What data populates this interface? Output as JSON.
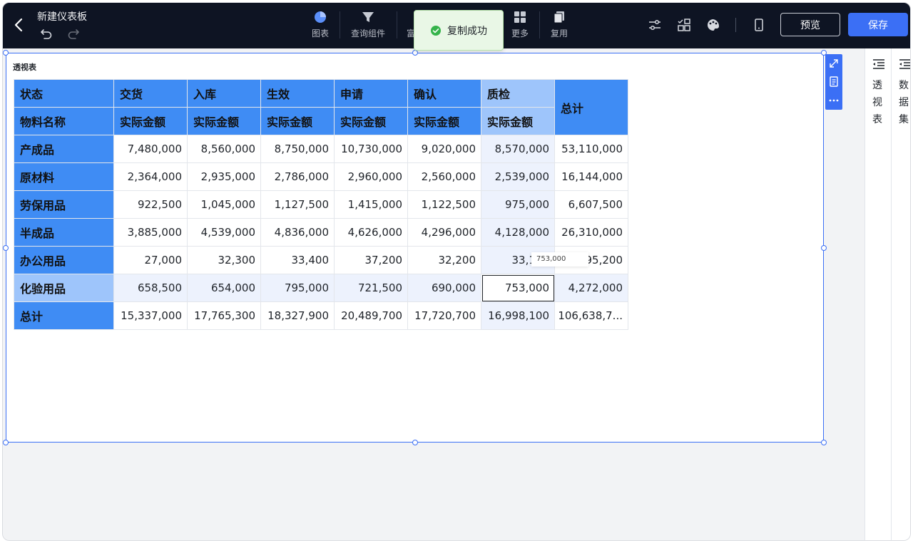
{
  "header": {
    "title": "新建仪表板",
    "toolbar": [
      {
        "label": "图表",
        "icon": "pie-chart-icon"
      },
      {
        "label": "查询组件",
        "icon": "filter-icon"
      },
      {
        "label": "富",
        "icon": "rich-text-icon"
      },
      {
        "label": "更多",
        "icon": "grid-icon"
      },
      {
        "label": "复用",
        "icon": "copy-icon"
      }
    ],
    "preview_label": "预览",
    "save_label": "保存"
  },
  "toast": {
    "message": "复制成功"
  },
  "widget": {
    "title": "透视表",
    "tooltip": "753,000"
  },
  "pivot": {
    "status_header": "状态",
    "material_header": "物料名称",
    "total_header": "总计",
    "statuses": [
      "交货",
      "入库",
      "生效",
      "申请",
      "确认",
      "质检"
    ],
    "measure": "实际金额",
    "rows": [
      {
        "name": "产成品",
        "values": [
          "7,480,000",
          "8,560,000",
          "8,750,000",
          "10,730,000",
          "9,020,000",
          "8,570,000"
        ],
        "total": "53,110,000"
      },
      {
        "name": "原材料",
        "values": [
          "2,364,000",
          "2,935,000",
          "2,786,000",
          "2,960,000",
          "2,560,000",
          "2,539,000"
        ],
        "total": "16,144,000"
      },
      {
        "name": "劳保用品",
        "values": [
          "922,500",
          "1,045,000",
          "1,127,500",
          "1,415,000",
          "1,122,500",
          "975,000"
        ],
        "total": "6,607,500"
      },
      {
        "name": "半成品",
        "values": [
          "3,885,000",
          "4,539,000",
          "4,836,000",
          "4,626,000",
          "4,296,000",
          "4,128,000"
        ],
        "total": "26,310,000"
      },
      {
        "name": "办公用品",
        "values": [
          "27,000",
          "32,300",
          "33,400",
          "37,200",
          "32,200",
          "33,100"
        ],
        "total": "195,200"
      },
      {
        "name": "化验用品",
        "values": [
          "658,500",
          "654,000",
          "795,000",
          "721,500",
          "690,000",
          "753,000"
        ],
        "total": "4,272,000"
      }
    ],
    "grand_total": {
      "name": "总计",
      "values": [
        "15,337,000",
        "17,765,300",
        "18,327,900",
        "20,489,700",
        "17,720,700",
        "16,998,100"
      ],
      "total": "106,638,7..."
    }
  },
  "panels": {
    "pivot_panel_label": "透视表",
    "dataset_panel_label": "数据集"
  }
}
